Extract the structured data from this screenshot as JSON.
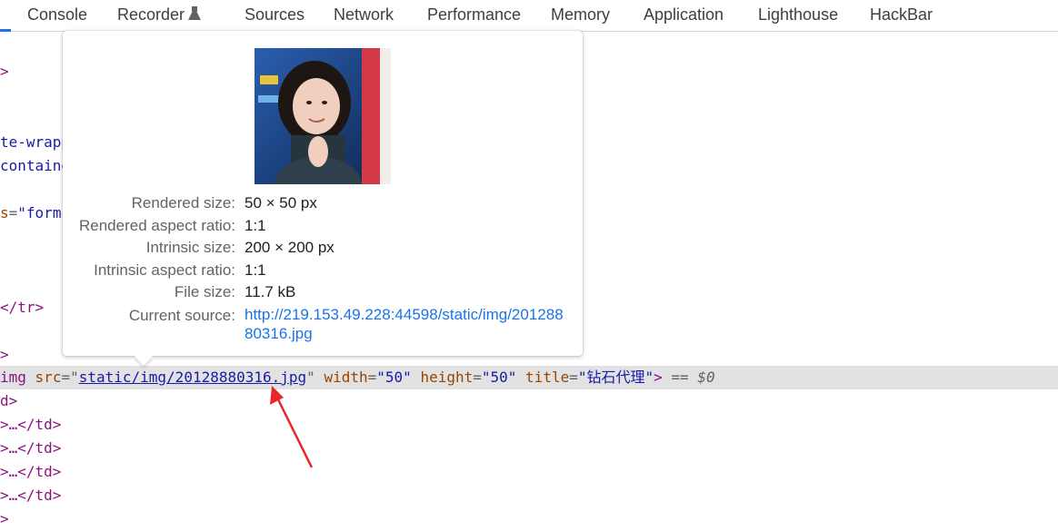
{
  "tabs": [
    {
      "label": "Console"
    },
    {
      "label": "Recorder"
    },
    {
      "label": "Sources"
    },
    {
      "label": "Network"
    },
    {
      "label": "Performance"
    },
    {
      "label": "Memory"
    },
    {
      "label": "Application"
    },
    {
      "label": "Lighthouse"
    },
    {
      "label": "HackBar"
    }
  ],
  "recorder_icon": "flask-icon",
  "code_lines": {
    "l1": ">",
    "l2": "te-wrapp",
    "l3": "containe",
    "l4_attr_tail": "s",
    "l4_val": "\"form-",
    "l5_close": "</tr>",
    "l6": ">",
    "selected": {
      "tag_open": "img",
      "src_attr": "src",
      "src_value": "static/img/20128880316.jpg",
      "width_attr": "width",
      "width_value": "\"50\"",
      "height_attr": "height",
      "height_value": "\"50\"",
      "title_attr": "title",
      "title_value": "\"钻石代理\"",
      "suffix": "== $0"
    },
    "after_selected": "d>",
    "td_rows": [
      ">…</td>",
      ">…</td>",
      ">…</td>",
      ">…</td>"
    ],
    "partial": ">"
  },
  "tooltip": {
    "rendered_size_label": "Rendered size:",
    "rendered_size_value": "50 × 50 px",
    "rendered_aspect_label": "Rendered aspect ratio:",
    "rendered_aspect_value": "1:1",
    "intrinsic_size_label": "Intrinsic size:",
    "intrinsic_size_value": "200 × 200 px",
    "intrinsic_aspect_label": "Intrinsic aspect ratio:",
    "intrinsic_aspect_value": "1:1",
    "file_size_label": "File size:",
    "file_size_value": "11.7 kB",
    "current_source_label": "Current source:",
    "current_source_value": "http://219.153.49.228:44598/static/img/20128880316.jpg"
  },
  "colors": {
    "accent": "#1a73e8",
    "tag": "#881280",
    "attr": "#994500",
    "value": "#1a1aa6",
    "annotation_arrow": "#e8262b"
  }
}
